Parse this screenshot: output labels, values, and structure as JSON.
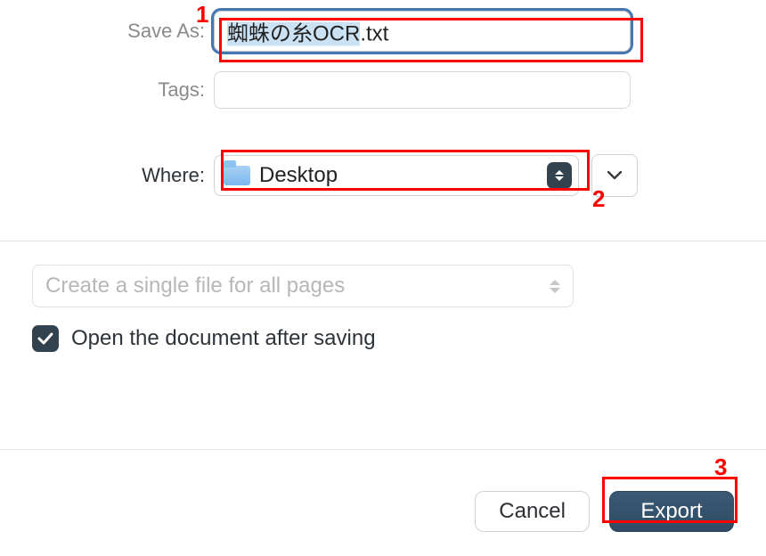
{
  "saveas": {
    "label": "Save As:",
    "filename": "蜘蛛の糸OCR",
    "extension": ".txt"
  },
  "tags": {
    "label": "Tags:",
    "value": ""
  },
  "where": {
    "label": "Where:",
    "location": "Desktop"
  },
  "options": {
    "single_file_label": "Create a single file for all pages",
    "open_after_label": "Open the document after saving",
    "open_after_checked": true
  },
  "footer": {
    "cancel": "Cancel",
    "export": "Export"
  },
  "annotations": {
    "one": "1",
    "two": "2",
    "three": "3"
  }
}
